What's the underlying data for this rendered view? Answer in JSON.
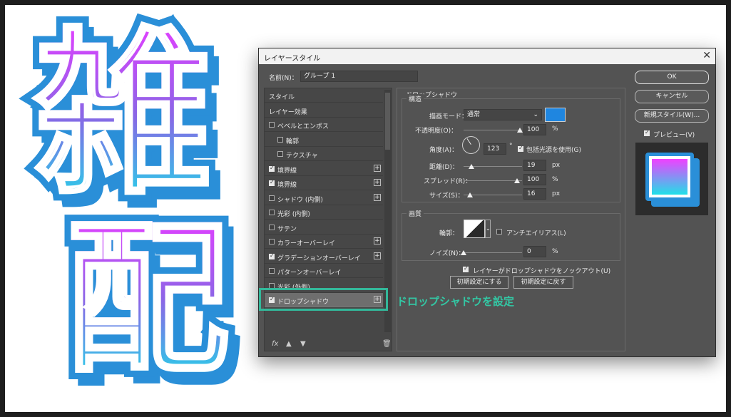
{
  "canvas": {
    "deco_text_top": "雑",
    "deco_text_bottom": "配"
  },
  "dialog": {
    "title": "レイヤースタイル",
    "name_label": "名前(N)：",
    "name_value": "グループ 1",
    "buttons": {
      "ok": "OK",
      "cancel": "キャンセル",
      "new_style": "新規スタイル(W)...",
      "preview": "プレビュー(V)"
    },
    "sidebar": {
      "items": [
        {
          "label": "スタイル",
          "checkbox": false,
          "checked": false,
          "indent": 0,
          "plus": false
        },
        {
          "label": "レイヤー効果",
          "checkbox": false,
          "checked": false,
          "indent": 0,
          "plus": false
        },
        {
          "label": "ベベルとエンボス",
          "checkbox": true,
          "checked": false,
          "indent": 0,
          "plus": false
        },
        {
          "label": "輪郭",
          "checkbox": true,
          "checked": false,
          "indent": 1,
          "plus": false
        },
        {
          "label": "テクスチャ",
          "checkbox": true,
          "checked": false,
          "indent": 1,
          "plus": false
        },
        {
          "label": "境界線",
          "checkbox": true,
          "checked": true,
          "indent": 0,
          "plus": true
        },
        {
          "label": "境界線",
          "checkbox": true,
          "checked": true,
          "indent": 0,
          "plus": true
        },
        {
          "label": "シャドウ (内側)",
          "checkbox": true,
          "checked": false,
          "indent": 0,
          "plus": true
        },
        {
          "label": "光彩 (内側)",
          "checkbox": true,
          "checked": false,
          "indent": 0,
          "plus": false
        },
        {
          "label": "サテン",
          "checkbox": true,
          "checked": false,
          "indent": 0,
          "plus": false
        },
        {
          "label": "カラーオーバーレイ",
          "checkbox": true,
          "checked": false,
          "indent": 0,
          "plus": true
        },
        {
          "label": "グラデーションオーバーレイ",
          "checkbox": true,
          "checked": true,
          "indent": 0,
          "plus": true
        },
        {
          "label": "パターンオーバーレイ",
          "checkbox": true,
          "checked": false,
          "indent": 0,
          "plus": false
        },
        {
          "label": "光彩 (外側)",
          "checkbox": true,
          "checked": false,
          "indent": 0,
          "plus": false
        },
        {
          "label": "ドロップシャドウ",
          "checkbox": true,
          "checked": true,
          "indent": 0,
          "plus": true,
          "selected": true
        }
      ],
      "fx_label": "fx"
    },
    "drop_shadow": {
      "section_title": "ドロップシャドウ",
      "structure_title": "構造",
      "blend_mode_label": "描画モード：",
      "blend_mode_value": "通常",
      "shadow_color": "#1f86e0",
      "opacity_label": "不透明度(O)：",
      "opacity_value": "100",
      "angle_label": "角度(A)：",
      "angle_value": "123",
      "angle_unit": "°",
      "global_light_label": "包括光源を使用(G)",
      "distance_label": "距離(D)：",
      "distance_value": "19",
      "spread_label": "スプレッド(R)：",
      "spread_value": "100",
      "size_label": "サイズ(S)：",
      "size_value": "16",
      "quality_title": "画質",
      "contour_label": "輪郭：",
      "antialias_label": "アンチエイリアス(L)",
      "noise_label": "ノイズ(N)：",
      "noise_value": "0",
      "knockout_label": "レイヤーがドロップシャドウをノックアウト(U)",
      "make_default": "初期設定にする",
      "reset_default": "初期設定に戻す",
      "unit_percent": "%",
      "unit_px": "px"
    }
  },
  "callout": {
    "text": "ドロップシャドウを設定",
    "color": "#33c7a4"
  }
}
